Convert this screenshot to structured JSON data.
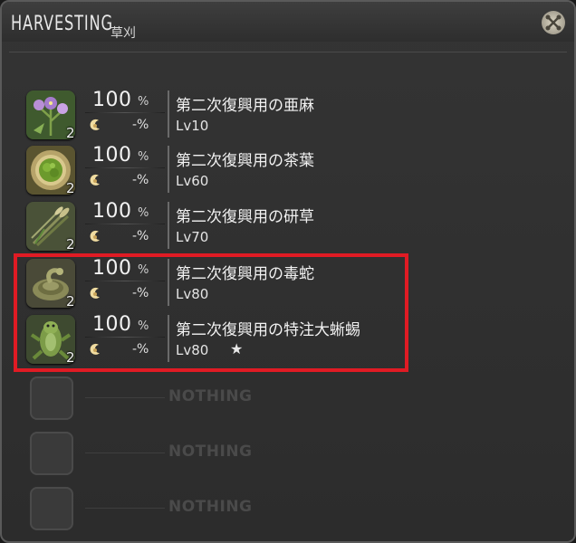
{
  "window": {
    "title": "HARVESTING",
    "subtitle": "草刈",
    "close_icon": "crossed-tools-icon"
  },
  "items": [
    {
      "name": "第二次復興用の亜麻",
      "level": "Lv10",
      "chance": "100",
      "chance_unit": "%",
      "hq_chance": "-%",
      "quantity": "2",
      "icon": "flax-flower-icon",
      "star": ""
    },
    {
      "name": "第二次復興用の茶葉",
      "level": "Lv60",
      "chance": "100",
      "chance_unit": "%",
      "hq_chance": "-%",
      "quantity": "2",
      "icon": "tea-leaves-bowl-icon",
      "star": ""
    },
    {
      "name": "第二次復興用の研草",
      "level": "Lv70",
      "chance": "100",
      "chance_unit": "%",
      "hq_chance": "-%",
      "quantity": "2",
      "icon": "grass-stalks-icon",
      "star": ""
    },
    {
      "name": "第二次復興用の毒蛇",
      "level": "Lv80",
      "chance": "100",
      "chance_unit": "%",
      "hq_chance": "-%",
      "quantity": "2",
      "icon": "coiled-snake-icon",
      "star": ""
    },
    {
      "name": "第二次復興用の特注大蜥蜴",
      "level": "Lv80",
      "chance": "100",
      "chance_unit": "%",
      "hq_chance": "-%",
      "quantity": "2",
      "icon": "lizard-icon",
      "star": "★"
    }
  ],
  "empty_slots": [
    {
      "label": "NOTHING"
    },
    {
      "label": "NOTHING"
    },
    {
      "label": "NOTHING"
    }
  ],
  "colors": {
    "highlight": "#e01b24",
    "text": "#f2f2f2",
    "empty_text": "#4a4a4a"
  }
}
